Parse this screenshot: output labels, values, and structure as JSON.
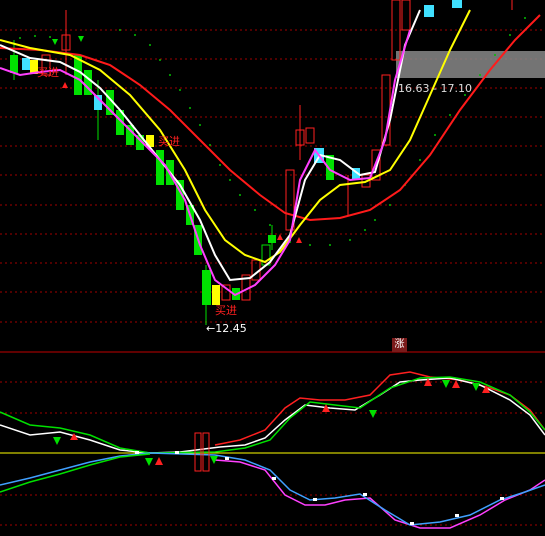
{
  "price_panel": {
    "range_label": "16.63 - 17.10",
    "low_label": "←12.45",
    "buy_label_1": "买进",
    "buy_label_2": "买进",
    "buy_label_3": "买进"
  },
  "indicator_panel": {
    "badge": "涨"
  },
  "colors": {
    "background": "#000000",
    "up_candle": "#ff2020",
    "down_candle_green": "#00e000",
    "down_candle_cyan": "#40e0ff",
    "ma_white": "#ffffff",
    "ma_yellow": "#ffff00",
    "ma_red": "#ff1a1a",
    "ma_magenta": "#ff40ff",
    "dotted_green": "#00c000",
    "grid_red": "#aa0000"
  }
}
